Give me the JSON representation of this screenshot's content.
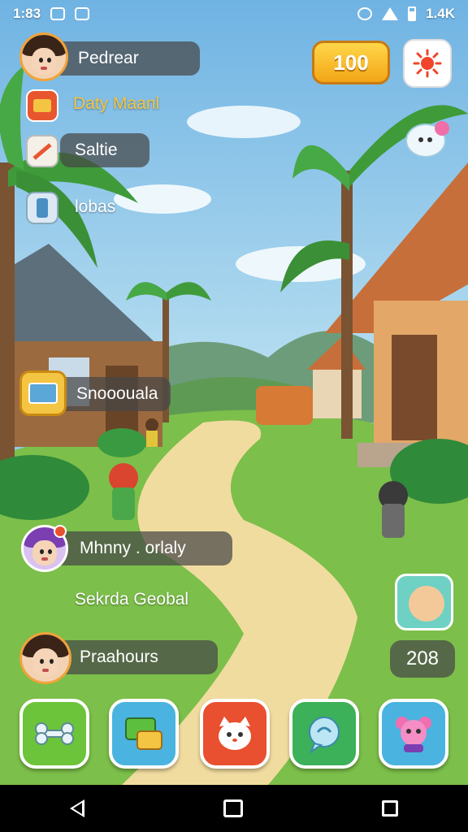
{
  "status_bar": {
    "time": "1:83",
    "right_text": "1.4K"
  },
  "profile": {
    "name": "Pedrear"
  },
  "currency": {
    "coins": "100"
  },
  "menu": [
    {
      "label": "Daty Maanl",
      "icon": "quest-scroll-icon",
      "color": "#f4c542"
    },
    {
      "label": "Saltie",
      "icon": "pencil-icon",
      "color": "#ffffff"
    },
    {
      "label": "lobas",
      "icon": "phone-icon",
      "color": "#ffffff"
    },
    {
      "label": "Snooouala",
      "icon": "shop-stall-icon",
      "color": "#ffffff"
    }
  ],
  "chat": {
    "friend_line": "Mhnny . orlaly",
    "social_line": "Sekrda Geobal"
  },
  "player": {
    "label": "Praahours"
  },
  "counter": "208",
  "bottom_bar": [
    {
      "icon": "bone-icon",
      "color": "#6cc43a"
    },
    {
      "icon": "chat-message-icon",
      "color": "#4ab3e0"
    },
    {
      "icon": "cat-face-icon",
      "color": "#e8502f"
    },
    {
      "icon": "speech-bubble-icon",
      "color": "#3db05a"
    },
    {
      "icon": "pink-bear-icon",
      "color": "#4ab3e0"
    }
  ]
}
